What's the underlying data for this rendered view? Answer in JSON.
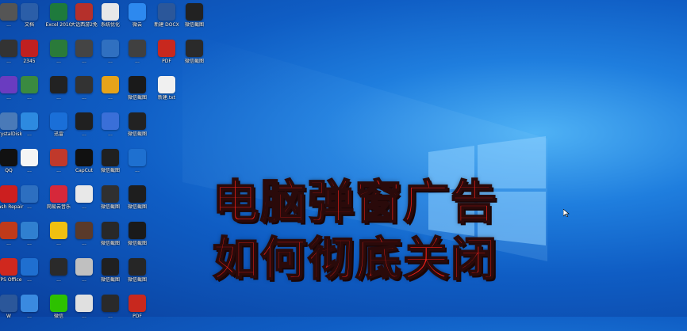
{
  "headline": {
    "line1": "电脑弹窗广告",
    "line2": "如何彻底关闭"
  },
  "colors": {
    "headline": "#f0201a",
    "desktop_bg": "#1f7ede"
  },
  "desktop_icons": [
    {
      "label": "...",
      "icon": "app-icon",
      "color": "#555555"
    },
    {
      "label": "文档",
      "icon": "folder-icon",
      "color": "#2b5ea8"
    },
    {
      "label": "Excel 2010",
      "icon": "excel-icon",
      "color": "#1e7a3c"
    },
    {
      "label": "大话西游2免",
      "icon": "game-icon",
      "color": "#b5302b"
    },
    {
      "label": "系统优化",
      "icon": "window-icon",
      "color": "#e8e8e8"
    },
    {
      "label": "微云",
      "icon": "cloud-icon",
      "color": "#2d89ef"
    },
    {
      "label": "新建 DOCX",
      "icon": "word-icon",
      "color": "#2b579a"
    },
    {
      "label": "微信截图",
      "icon": "screenshot-icon",
      "color": "#222222"
    },
    {
      "label": "...",
      "icon": "app-icon",
      "color": "#333333"
    },
    {
      "label": "2345",
      "icon": "browser-icon",
      "color": "#c02020"
    },
    {
      "label": "...",
      "icon": "app-icon",
      "color": "#2a7a3a"
    },
    {
      "label": "...",
      "icon": "app-icon",
      "color": "#444444"
    },
    {
      "label": "...",
      "icon": "app-icon",
      "color": "#3070c0"
    },
    {
      "label": "...",
      "icon": "app-icon",
      "color": "#404040"
    },
    {
      "label": "PDF",
      "icon": "pdf-icon",
      "color": "#c8281e"
    },
    {
      "label": "微信截图",
      "icon": "screenshot-icon",
      "color": "#2a2a2a"
    },
    {
      "label": "...",
      "icon": "app-icon",
      "color": "#6a3cc0"
    },
    {
      "label": "...",
      "icon": "app-icon",
      "color": "#3a8a40"
    },
    {
      "label": "...",
      "icon": "app-icon",
      "color": "#222222"
    },
    {
      "label": "...",
      "icon": "eye-icon",
      "color": "#333333"
    },
    {
      "label": "...",
      "icon": "app-icon",
      "color": "#e6a31a"
    },
    {
      "label": "微信截图",
      "icon": "screenshot-icon",
      "color": "#1a1a1a"
    },
    {
      "label": "新建.txt",
      "icon": "text-file-icon",
      "color": "#f0f0f0"
    },
    {
      "label": "",
      "icon": "empty",
      "color": "transparent"
    },
    {
      "label": "CrystalDisk",
      "icon": "disk-icon",
      "color": "#4a7ab8"
    },
    {
      "label": "...",
      "icon": "app-icon",
      "color": "#2d8ae0"
    },
    {
      "label": "迅雷",
      "icon": "thunder-icon",
      "color": "#1a6fd8"
    },
    {
      "label": "...",
      "icon": "app-icon",
      "color": "#202020"
    },
    {
      "label": "...",
      "icon": "app-icon",
      "color": "#3a6fd8"
    },
    {
      "label": "微信截图",
      "icon": "screenshot-icon",
      "color": "#222222"
    },
    {
      "label": "",
      "icon": "empty",
      "color": "transparent"
    },
    {
      "label": "",
      "icon": "empty",
      "color": "transparent"
    },
    {
      "label": "QQ",
      "icon": "qq-icon",
      "color": "#111111"
    },
    {
      "label": "...",
      "icon": "app-icon",
      "color": "#f5f5f5"
    },
    {
      "label": "...",
      "icon": "app-icon",
      "color": "#c0392b"
    },
    {
      "label": "CapCut",
      "icon": "capcut-icon",
      "color": "#111111"
    },
    {
      "label": "微信截图",
      "icon": "screenshot-icon",
      "color": "#202020"
    },
    {
      "label": "...",
      "icon": "app-icon",
      "color": "#1e70d0"
    },
    {
      "label": "",
      "icon": "empty",
      "color": "transparent"
    },
    {
      "label": "",
      "icon": "empty",
      "color": "transparent"
    },
    {
      "label": "Flash Repair",
      "icon": "flash-icon",
      "color": "#cc1f1f"
    },
    {
      "label": "...",
      "icon": "app-icon",
      "color": "#2d6fc0"
    },
    {
      "label": "网易云音乐",
      "icon": "music-icon",
      "color": "#d6283a"
    },
    {
      "label": "...",
      "icon": "app-icon",
      "color": "#e8e8e8"
    },
    {
      "label": "微信截图",
      "icon": "screenshot-icon",
      "color": "#303030"
    },
    {
      "label": "微信截图",
      "icon": "screenshot-icon",
      "color": "#1e1e1e"
    },
    {
      "label": "",
      "icon": "empty",
      "color": "transparent"
    },
    {
      "label": "",
      "icon": "empty",
      "color": "transparent"
    },
    {
      "label": "...",
      "icon": "app-icon",
      "color": "#c03a1a"
    },
    {
      "label": "...",
      "icon": "app-icon",
      "color": "#3080d0"
    },
    {
      "label": "...",
      "icon": "app-icon",
      "color": "#f0c010"
    },
    {
      "label": "...",
      "icon": "app-icon",
      "color": "#5a3a2a"
    },
    {
      "label": "微信截图",
      "icon": "screenshot-icon",
      "color": "#282828"
    },
    {
      "label": "微信截图",
      "icon": "screenshot-icon",
      "color": "#1a1a1a"
    },
    {
      "label": "",
      "icon": "empty",
      "color": "transparent"
    },
    {
      "label": "",
      "icon": "empty",
      "color": "transparent"
    },
    {
      "label": "WPS Office",
      "icon": "wps-icon",
      "color": "#d0281e"
    },
    {
      "label": "...",
      "icon": "app-icon",
      "color": "#1f6fd0"
    },
    {
      "label": "...",
      "icon": "app-icon",
      "color": "#2a2a2a"
    },
    {
      "label": "...",
      "icon": "app-icon",
      "color": "#c0c0c0"
    },
    {
      "label": "微信截图",
      "icon": "screenshot-icon",
      "color": "#202020"
    },
    {
      "label": "微信截图",
      "icon": "screenshot-icon",
      "color": "#262626"
    },
    {
      "label": "",
      "icon": "empty",
      "color": "transparent"
    },
    {
      "label": "",
      "icon": "empty",
      "color": "transparent"
    },
    {
      "label": "W",
      "icon": "word-icon",
      "color": "#2b579a"
    },
    {
      "label": "...",
      "icon": "app-icon",
      "color": "#3a8ae0"
    },
    {
      "label": "微信",
      "icon": "wechat-icon",
      "color": "#2dc100"
    },
    {
      "label": "...",
      "icon": "app-icon",
      "color": "#e0e0e0"
    },
    {
      "label": "...",
      "icon": "app-icon",
      "color": "#2a2a2a"
    },
    {
      "label": "PDF",
      "icon": "pdf-icon",
      "color": "#c8281e"
    },
    {
      "label": "",
      "icon": "empty",
      "color": "transparent"
    },
    {
      "label": "",
      "icon": "empty",
      "color": "transparent"
    }
  ]
}
